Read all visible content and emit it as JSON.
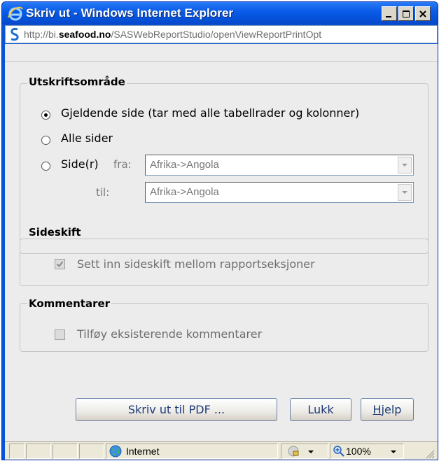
{
  "window": {
    "title": "Skriv ut - Windows Internet Explorer",
    "address_prefix": "http://bi.",
    "address_domain": "seafood.no",
    "address_path": "/SASWebReportStudio/openViewReportPrintOpt"
  },
  "print_area": {
    "legend": "Utskriftsområde",
    "current_page_label": "Gjeldende side (tar med alle tabellrader og kolonner)",
    "all_pages_label": "Alle sider",
    "pages_label": "Side(r)",
    "from_label": "fra:",
    "to_label": "til:",
    "from_value": "Afrika->Angola",
    "to_value": "Afrika->Angola",
    "selected": "current_page"
  },
  "page_break": {
    "legend": "Sideskift",
    "checkbox_label": "Sett inn sideskift mellom rapportseksjoner",
    "checked": true
  },
  "comments": {
    "legend": "Kommentarer",
    "checkbox_label": "Tilføy eksisterende kommentarer",
    "checked": false
  },
  "buttons": {
    "print_pdf": "Skriv ut til PDF ...",
    "close": "Lukk",
    "help_mnemonic": "H",
    "help_rest": "jelp"
  },
  "statusbar": {
    "zone": "Internet",
    "zoom": "100%"
  }
}
